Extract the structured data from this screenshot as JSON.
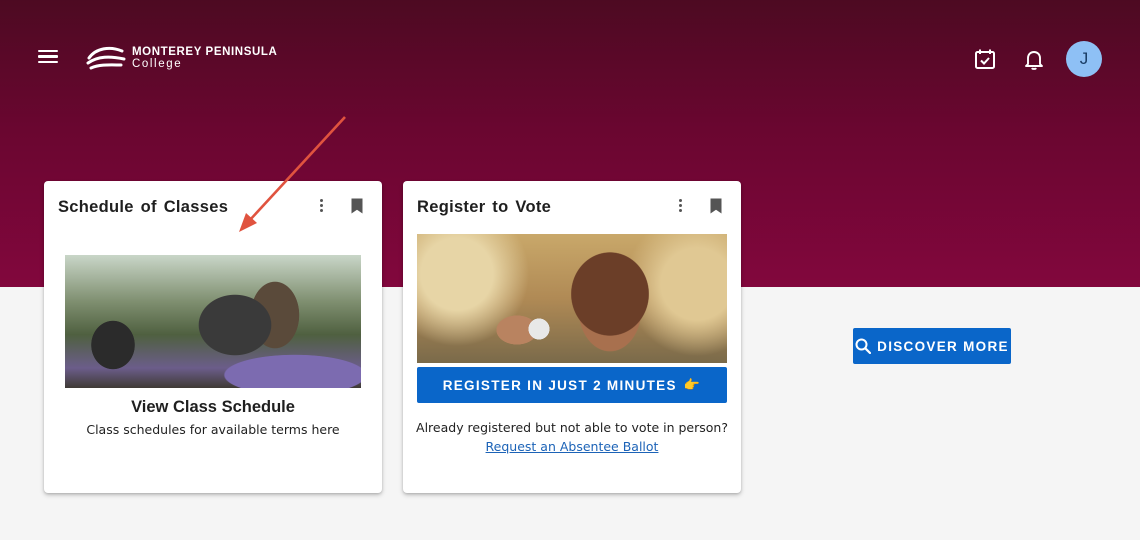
{
  "header": {
    "logo": {
      "line1": "MONTEREY PENINSULA",
      "line2": "College"
    },
    "menu_icon": "hamburger-menu-icon",
    "icons": [
      "calendar-check-icon",
      "bell-icon"
    ],
    "avatar_initial": "J"
  },
  "cards": [
    {
      "title": "Schedule of Classes",
      "link_heading": "View Class Schedule",
      "description": "Class schedules for available terms here",
      "icons": [
        "more-vert-icon",
        "bookmark-icon"
      ]
    },
    {
      "title": "Register to Vote",
      "button_label": "REGISTER IN JUST 2 MINUTES",
      "button_emoji": "👉",
      "text": "Already registered but not able to vote in person?",
      "link": "Request an Absentee Ballot",
      "icons": [
        "more-vert-icon",
        "bookmark-icon"
      ]
    }
  ],
  "discover_button": {
    "label": "DISCOVER MORE",
    "icon": "search-icon"
  },
  "colors": {
    "header_gradient_top": "#4d0a22",
    "header_gradient_bottom": "#82073d",
    "primary_button": "#0a66c9",
    "link": "#1c63b7",
    "avatar": "#8ec0f5",
    "annotation_arrow": "#e0533f"
  }
}
